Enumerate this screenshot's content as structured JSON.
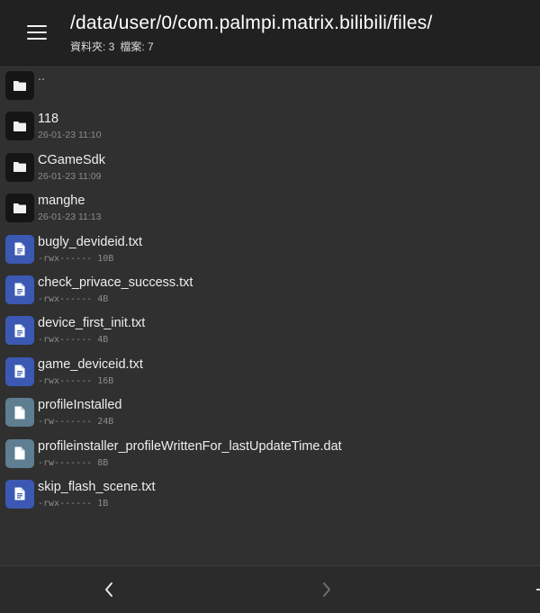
{
  "header": {
    "path": "/data/user/0/com.palmpi.matrix.bilibili/files/",
    "folders_label": "資料夾: 3",
    "files_label": "檔案: 7"
  },
  "parent_entry": {
    "name": ".."
  },
  "items": [
    {
      "name": "118",
      "meta": "26-01-23 11:10",
      "kind": "folder"
    },
    {
      "name": "CGameSdk",
      "meta": "26-01-23 11:09",
      "kind": "folder"
    },
    {
      "name": "manghe",
      "meta": "26-01-23 11:13",
      "kind": "folder"
    },
    {
      "name": "bugly_devideid.txt",
      "meta": "-rwx------ 10B",
      "kind": "text"
    },
    {
      "name": "check_privace_success.txt",
      "meta": "-rwx------ 4B",
      "kind": "text"
    },
    {
      "name": "device_first_init.txt",
      "meta": "-rwx------ 4B",
      "kind": "text"
    },
    {
      "name": "game_deviceid.txt",
      "meta": "-rwx------ 16B",
      "kind": "text"
    },
    {
      "name": "profileInstalled",
      "meta": "-rw------- 24B",
      "kind": "generic"
    },
    {
      "name": "profileinstaller_profileWrittenFor_lastUpdateTime.dat",
      "meta": "-rw------- 8B",
      "kind": "generic"
    },
    {
      "name": "skip_flash_scene.txt",
      "meta": "-rwx------ 1B",
      "kind": "text"
    }
  ],
  "icons": {
    "menu": "menu-icon",
    "folder": "folder-icon",
    "text": "text-file-icon",
    "generic": "file-icon",
    "back": "chevron-left-icon",
    "forward": "chevron-right-icon",
    "extra": "more-icon"
  },
  "colors": {
    "header_bg": "#212121",
    "list_bg": "#303030",
    "folder_icon_bg": "#151515",
    "text_icon_bg": "#3b59b3",
    "generic_icon_bg": "#5f7e91"
  }
}
